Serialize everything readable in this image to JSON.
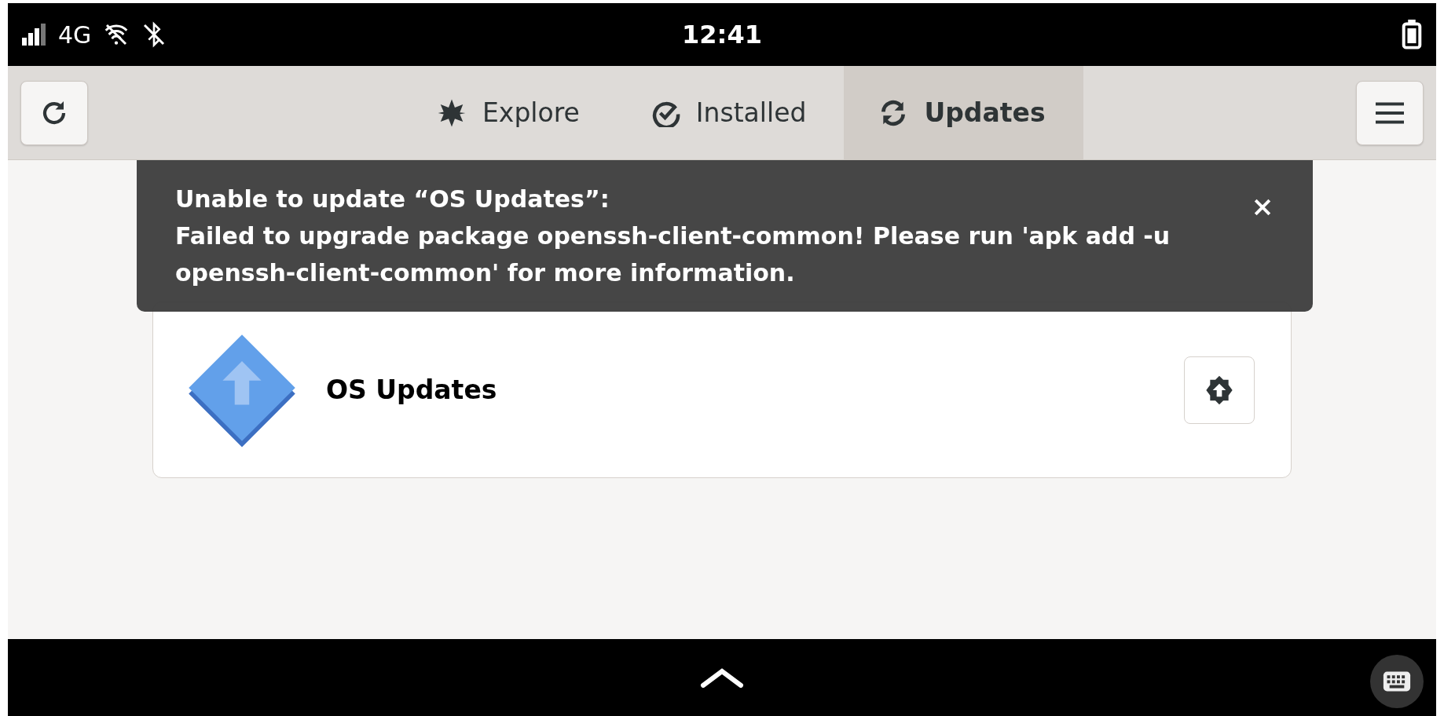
{
  "status_bar": {
    "network": "4G",
    "time": "12:41"
  },
  "header": {
    "tabs": [
      {
        "label": "Explore",
        "kind": "explore",
        "selected": false
      },
      {
        "label": "Installed",
        "kind": "installed",
        "selected": false
      },
      {
        "label": "Updates",
        "kind": "updates",
        "selected": true
      }
    ]
  },
  "toast": {
    "title": "Unable to update “OS Updates”:",
    "message": "Failed to upgrade package openssh-client-common! Please run 'apk add -u openssh-client-common' for more information."
  },
  "updates": [
    {
      "name": "OS Updates"
    }
  ]
}
